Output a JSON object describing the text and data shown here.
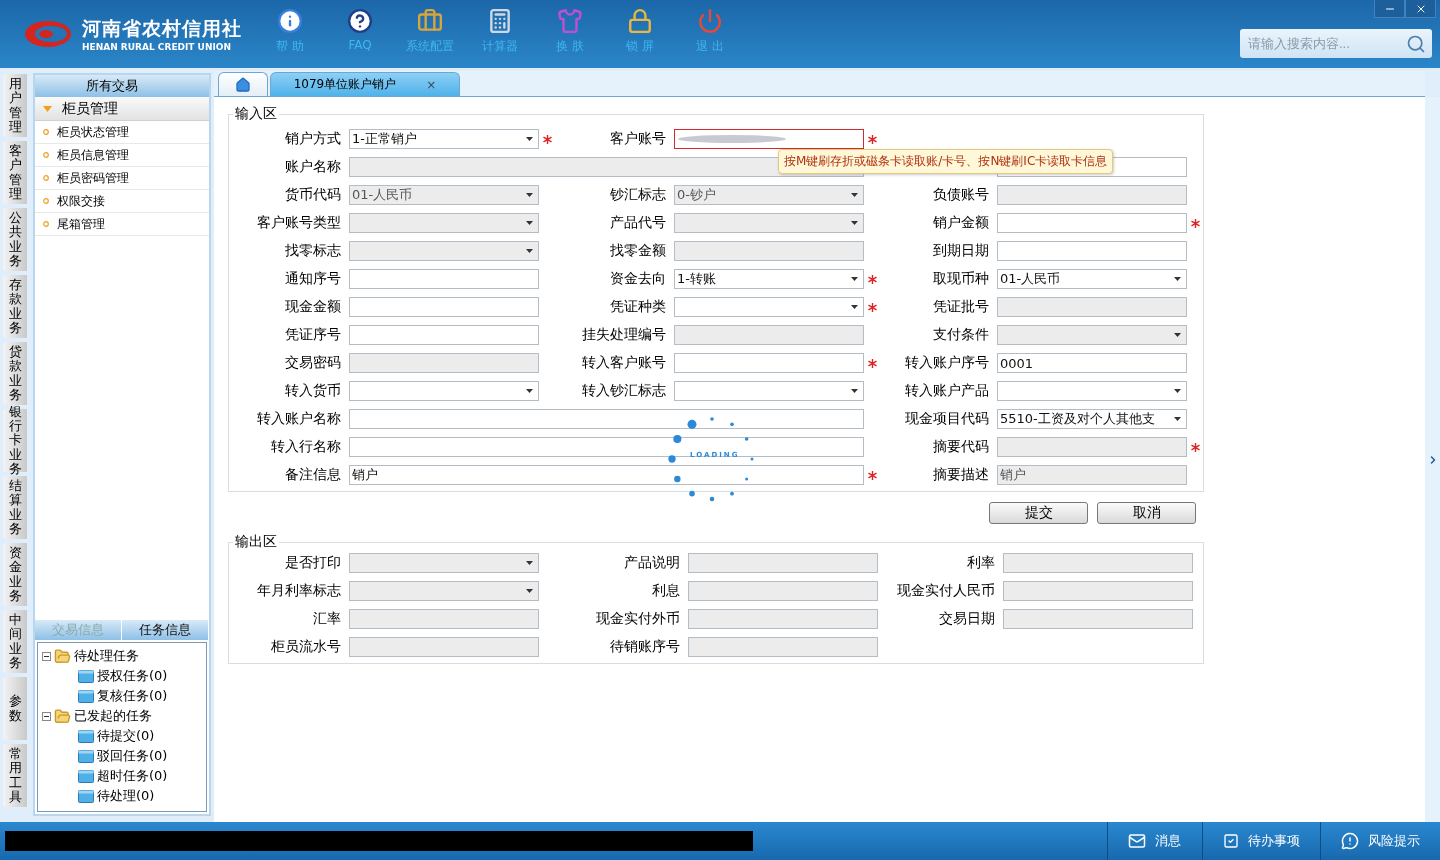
{
  "logo": {
    "title": "河南省农村信用社",
    "subtitle": "HENAN RURAL CREDIT UNION"
  },
  "toolbar": [
    {
      "label": "帮 助",
      "kind": "info"
    },
    {
      "label": "FAQ",
      "kind": "faq"
    },
    {
      "label": "系统配置",
      "kind": "config"
    },
    {
      "label": "计算器",
      "kind": "calc"
    },
    {
      "label": "换 肤",
      "kind": "skin"
    },
    {
      "label": "锁 屏",
      "kind": "lock"
    },
    {
      "label": "退 出",
      "kind": "exit"
    }
  ],
  "search": {
    "placeholder": "请输入搜索内容..."
  },
  "side_tabs": [
    "用户管理",
    "客户管理",
    "公共业务",
    "存款业务",
    "贷款业务",
    "银行卡业务",
    "结算业务",
    "资金业务",
    "中间业务",
    "参数",
    "常用工具"
  ],
  "nav": {
    "title": "所有交易",
    "group": {
      "label": "柜员管理",
      "expanded": true,
      "items": [
        "柜员状态管理",
        "柜员信息管理",
        "柜员密码管理",
        "权限交接",
        "尾箱管理"
      ]
    }
  },
  "info_panel": {
    "tabs": [
      {
        "label": "交易信息",
        "selected": false
      },
      {
        "label": "任务信息",
        "selected": true
      }
    ],
    "tree": [
      {
        "label": "待处理任务",
        "expanded": true,
        "children": [
          {
            "label": "授权任务(0)"
          },
          {
            "label": "复核任务(0)"
          }
        ]
      },
      {
        "label": "已发起的任务",
        "expanded": true,
        "children": [
          {
            "label": "待提交(0)"
          },
          {
            "label": "驳回任务(0)"
          },
          {
            "label": "超时任务(0)"
          },
          {
            "label": "待处理(0)"
          }
        ]
      }
    ]
  },
  "doc_tabs": [
    {
      "kind": "home",
      "selected": false
    },
    {
      "kind": "page",
      "label": "1079单位账户销户",
      "close": "×",
      "selected": true
    }
  ],
  "input_area": {
    "title": "输入区",
    "rows": [
      [
        {
          "label": "销户方式",
          "kind": "select",
          "value": "1-正常销户",
          "required": true
        },
        {
          "label": "客户账号",
          "kind": "text",
          "invalid": true,
          "redacted": true,
          "required": true,
          "hint": "按M键刷存折或磁条卡读取账/卡号、按N键刷IC卡读取卡信息"
        }
      ],
      [
        {
          "label": "账户名称",
          "kind": "wide",
          "disabled": true
        },
        {
          "kind": "text"
        }
      ],
      [
        {
          "label": "货币代码",
          "kind": "select",
          "value": "01-人民币",
          "disabled": true
        },
        {
          "label": "钞汇标志",
          "kind": "select",
          "value": "0-钞户",
          "disabled": true
        },
        {
          "label": "负债账号",
          "kind": "text",
          "disabled": true
        }
      ],
      [
        {
          "label": "客户账号类型",
          "kind": "select",
          "disabled": true
        },
        {
          "label": "产品代号",
          "kind": "select",
          "disabled": true
        },
        {
          "label": "销户金额",
          "kind": "text",
          "required": true
        }
      ],
      [
        {
          "label": "找零标志",
          "kind": "select",
          "disabled": true
        },
        {
          "label": "找零金额",
          "kind": "text",
          "disabled": true
        },
        {
          "label": "到期日期",
          "kind": "text"
        }
      ],
      [
        {
          "label": "通知序号",
          "kind": "text"
        },
        {
          "label": "资金去向",
          "kind": "select",
          "value": "1-转账",
          "required": true
        },
        {
          "label": "取现币种",
          "kind": "select",
          "value": "01-人民币"
        }
      ],
      [
        {
          "label": "现金金额",
          "kind": "text"
        },
        {
          "label": "凭证种类",
          "kind": "select",
          "required": true
        },
        {
          "label": "凭证批号",
          "kind": "text",
          "disabled": true
        }
      ],
      [
        {
          "label": "凭证序号",
          "kind": "text"
        },
        {
          "label": "挂失处理编号",
          "kind": "text",
          "disabled": true
        },
        {
          "label": "支付条件",
          "kind": "select",
          "disabled": true
        }
      ],
      [
        {
          "label": "交易密码",
          "kind": "text",
          "disabled": true
        },
        {
          "label": "转入客户账号",
          "kind": "text",
          "required": true
        },
        {
          "label": "转入账户序号",
          "kind": "text",
          "value": "0001"
        }
      ],
      [
        {
          "label": "转入货币",
          "kind": "select"
        },
        {
          "label": "转入钞汇标志",
          "kind": "select"
        },
        {
          "label": "转入账户产品",
          "kind": "select"
        }
      ],
      [
        {
          "label": "转入账户名称",
          "kind": "wide"
        },
        {
          "label": "现金项目代码",
          "kind": "select",
          "value": "5510-工资及对个人其他支"
        }
      ],
      [
        {
          "label": "转入行名称",
          "kind": "wide"
        },
        {
          "label": "摘要代码",
          "kind": "text",
          "disabled": true,
          "required": true
        }
      ],
      [
        {
          "label": "备注信息",
          "kind": "wide",
          "value": "销户",
          "required": true
        },
        {
          "label": "摘要描述",
          "kind": "text",
          "value": "销户",
          "disabled": true
        }
      ]
    ]
  },
  "loading": {
    "text": "LOADING"
  },
  "buttons": [
    "提交",
    "取消"
  ],
  "output_area": {
    "title": "输出区",
    "rows": [
      [
        {
          "label": "是否打印",
          "kind": "select",
          "disabled": true
        },
        {
          "label": "产品说明",
          "kind": "text",
          "disabled": true
        },
        {
          "label": "利率",
          "kind": "text",
          "disabled": true
        }
      ],
      [
        {
          "label": "年月利率标志",
          "kind": "select",
          "disabled": true
        },
        {
          "label": "利息",
          "kind": "text",
          "disabled": true
        },
        {
          "label": "现金实付人民币",
          "kind": "text",
          "disabled": true
        }
      ],
      [
        {
          "label": "汇率",
          "kind": "text",
          "disabled": true
        },
        {
          "label": "现金实付外币",
          "kind": "text",
          "disabled": true
        },
        {
          "label": "交易日期",
          "kind": "text",
          "disabled": true
        }
      ],
      [
        {
          "label": "柜员流水号",
          "kind": "text",
          "disabled": true
        },
        {
          "label": "待销账序号",
          "kind": "text",
          "disabled": true
        }
      ]
    ]
  },
  "status_bar": [
    {
      "label": "消息",
      "kind": "message"
    },
    {
      "label": "待办事项",
      "kind": "todo"
    },
    {
      "label": "风险提示",
      "kind": "risk"
    }
  ]
}
